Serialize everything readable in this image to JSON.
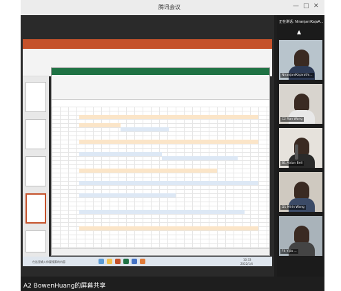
{
  "meeting": {
    "title": "腾讯会议",
    "controls": [
      "—",
      "□",
      "✕"
    ]
  },
  "share": {
    "sharer_label": "A2 BowenHuang的屏幕共享"
  },
  "participants_panel": {
    "header": "正在讲话: NiranjaniKajaA...",
    "tiles": [
      {
        "name": "NiranjaniKajarathi..."
      },
      {
        "name": "C2 Ran Wang"
      },
      {
        "name": "B1 Aidan Bell"
      },
      {
        "name": "D1 Mirin Wang"
      },
      {
        "name": "F4 Yijia ..."
      }
    ]
  },
  "taskbar": {
    "search_placeholder": "在这里输入你要搜索的内容",
    "time": "10:33",
    "date": "2022/1/4"
  },
  "colors": {
    "ppt_brand": "#c5522b",
    "excel_brand": "#1f7244",
    "highlight_orange": "#fbe5c8",
    "highlight_blue": "#dde8f5"
  }
}
